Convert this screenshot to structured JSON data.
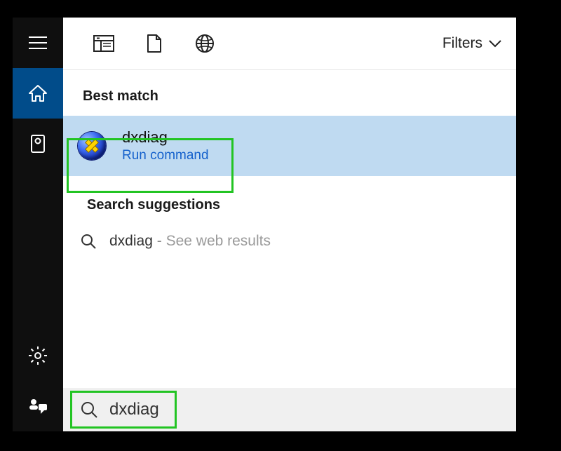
{
  "topbar": {
    "filters_label": "Filters"
  },
  "sections": {
    "best_match": "Best match",
    "search_suggestions": "Search suggestions"
  },
  "result": {
    "title": "dxdiag",
    "subtitle": "Run command"
  },
  "suggestion": {
    "term": "dxdiag",
    "separator": "-",
    "web_label": "See web results"
  },
  "search": {
    "query": "dxdiag"
  }
}
